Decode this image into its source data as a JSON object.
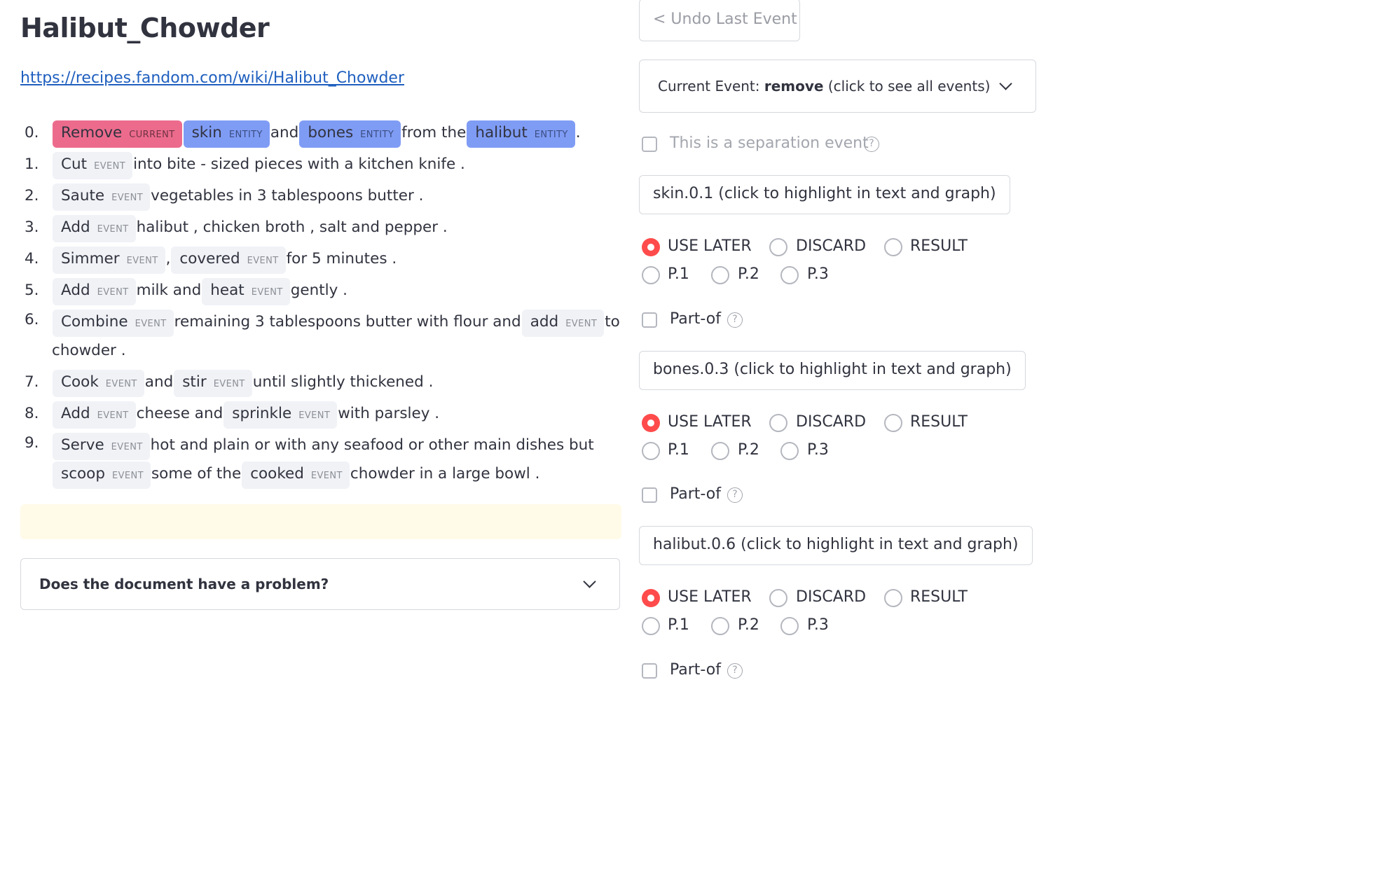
{
  "doc": {
    "title": "Halibut_Chowder",
    "link": "https://recipes.fandom.com/wiki/Halibut_Chowder"
  },
  "labels": {
    "current": "CURRENT",
    "entity": "ENTITY",
    "event": "EVENT"
  },
  "steps": [
    {
      "num": "0.",
      "t": [
        "Remove",
        "skin",
        "and",
        "bones",
        "from the",
        "halibut",
        "."
      ]
    },
    {
      "num": "1.",
      "t": [
        "Cut",
        "into bite - sized pieces with a kitchen knife ."
      ]
    },
    {
      "num": "2.",
      "t": [
        "Saute",
        "vegetables in 3 tablespoons butter ."
      ]
    },
    {
      "num": "3.",
      "t": [
        "Add",
        "halibut , chicken broth , salt and pepper ."
      ]
    },
    {
      "num": "4.",
      "t": [
        "Simmer",
        ",",
        "covered",
        "for 5 minutes ."
      ]
    },
    {
      "num": "5.",
      "t": [
        "Add",
        "milk and",
        "heat",
        "gently ."
      ]
    },
    {
      "num": "6.",
      "t": [
        "Combine",
        "remaining 3 tablespoons butter with flour and",
        "add",
        "to chowder ."
      ]
    },
    {
      "num": "7.",
      "t": [
        "Cook",
        "and",
        "stir",
        "until slightly thickened ."
      ]
    },
    {
      "num": "8.",
      "t": [
        "Add",
        "cheese and",
        "sprinkle",
        "with parsley ."
      ]
    },
    {
      "num": "9.",
      "t": [
        "Serve",
        "hot and plain or with any seafood or other main dishes but",
        "scoop",
        "some of the",
        "cooked",
        "chowder in a large bowl ."
      ]
    }
  ],
  "problem_expander": {
    "label": "Does the document have a problem?"
  },
  "right_panel": {
    "undo_label": "< Undo Last Event",
    "event_select": {
      "prefix": "Current Event: ",
      "event": "remove",
      "suffix": " (click to see all events)"
    },
    "separation_label": "This is a separation event",
    "help_glyph": "?",
    "entities": [
      {
        "button": "skin.0.1 (click to highlight in text and graph)",
        "options": [
          "USE LATER",
          "DISCARD",
          "RESULT",
          "P.1",
          "P.2",
          "P.3"
        ],
        "selected": "USE LATER",
        "part_of": "Part-of"
      },
      {
        "button": "bones.0.3 (click to highlight in text and graph)",
        "options": [
          "USE LATER",
          "DISCARD",
          "RESULT",
          "P.1",
          "P.2",
          "P.3"
        ],
        "selected": "USE LATER",
        "part_of": "Part-of"
      },
      {
        "button": "halibut.0.6 (click to highlight in text and graph)",
        "options": [
          "USE LATER",
          "DISCARD",
          "RESULT",
          "P.1",
          "P.2",
          "P.3"
        ],
        "selected": "USE LATER",
        "part_of": "Part-of"
      }
    ]
  },
  "colors": {
    "current": "#ec6b8d",
    "entity": "#7f9cf5",
    "event": "#f0f2f6",
    "radio_selected": "#ff4b4b",
    "link": "#1f5fbf",
    "notice": "#fffbe8"
  }
}
